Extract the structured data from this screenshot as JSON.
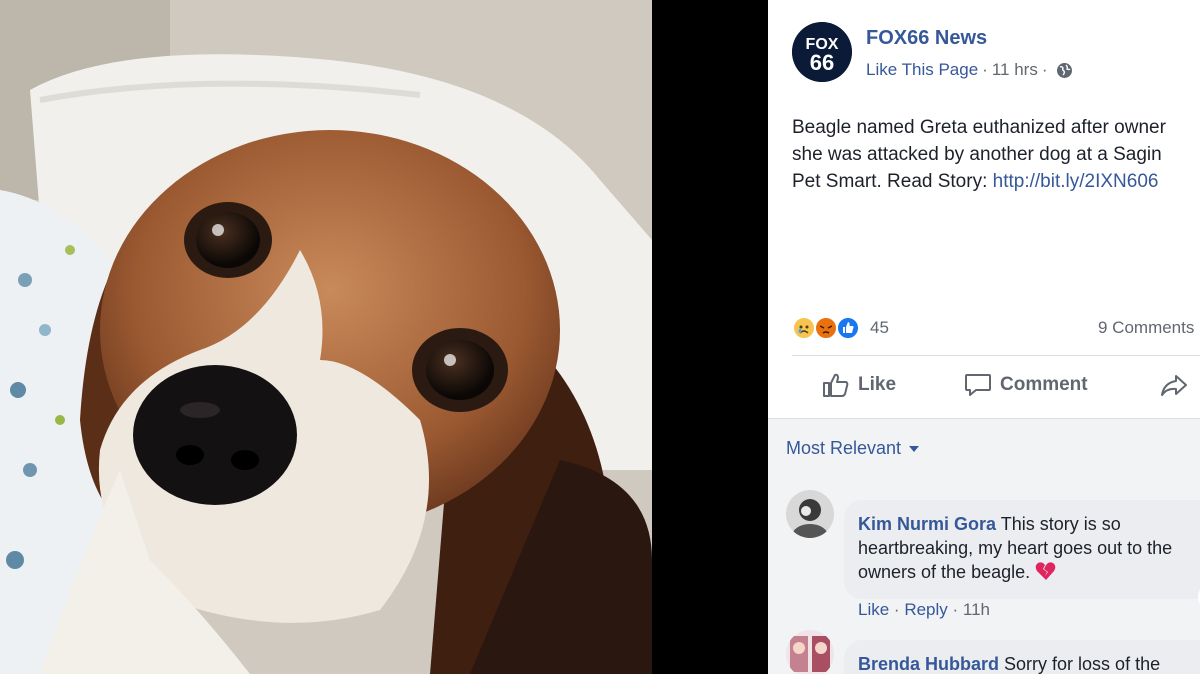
{
  "post": {
    "page_name": "FOX66 News",
    "like_page": "Like This Page",
    "time": "11 hrs",
    "privacy_icon": "globe-icon",
    "text_line1": "Beagle named Greta euthanized after owner",
    "text_line2": "she was attacked by another dog at a Sagin",
    "text_line3_prefix": "Pet Smart. Read Story: ",
    "text_link": "http://bit.ly/2IXN606"
  },
  "reactions": {
    "icons": [
      "sad-reaction-icon",
      "angry-reaction-icon",
      "like-reaction-icon"
    ],
    "count": "45",
    "comments": "9 Comments"
  },
  "actions": {
    "like": "Like",
    "comment": "Comment"
  },
  "comments_section": {
    "sort_label": "Most Relevant",
    "items": [
      {
        "author": "Kim Nurmi Gora",
        "line1": "This story is so",
        "line2": "heartbreaking, my heart goes out to the",
        "line3": "owners of the beagle.",
        "emoji_icon": "broken-heart-icon",
        "like": "Like",
        "reply": "Reply",
        "time": "11h"
      },
      {
        "author": "Brenda Hubbard",
        "line1": "Sorry for loss of the"
      }
    ]
  },
  "colors": {
    "link_blue": "#365899",
    "text": "#1d2129",
    "muted": "#616770",
    "fb_blue": "#1877f2"
  }
}
